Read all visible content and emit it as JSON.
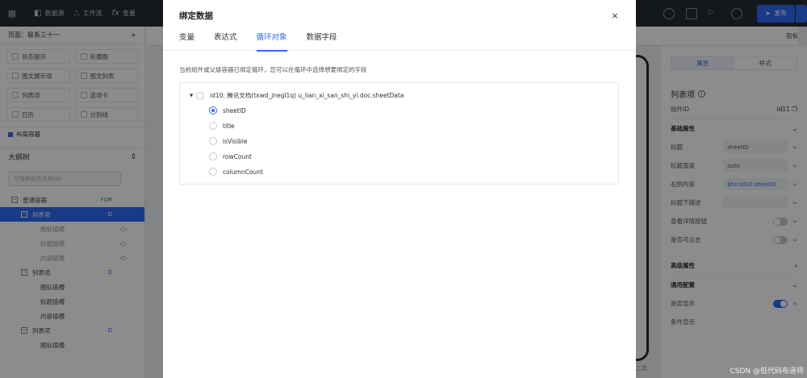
{
  "background": {
    "topbar": {
      "nav": [
        {
          "icon": "database-icon",
          "label": "数据源"
        },
        {
          "icon": "workflow-icon",
          "label": "工作流"
        },
        {
          "icon": "fx-icon",
          "label": "变量"
        }
      ],
      "publish_label": "发布"
    },
    "left_panel": {
      "page_label": "页面：联系三十一",
      "add_label": "+",
      "components": [
        "状态提示",
        "轮播图",
        "图文展示项",
        "图文列表",
        "列表项",
        "选项卡",
        "日历",
        "分割线"
      ],
      "section_label": "布局容器",
      "outline_title": "大纲树",
      "outline_search_placeholder": "可搜索组件名称/ID",
      "tree": [
        {
          "label": "普通容器",
          "badge": "FOR"
        },
        {
          "label": "列表项",
          "badge": "D",
          "selected": true
        },
        {
          "label": "图标插槽"
        },
        {
          "label": "标题插槽"
        },
        {
          "label": "内容插槽"
        },
        {
          "label": "列表项",
          "badge": "D"
        },
        {
          "label": "图标插槽"
        },
        {
          "label": "标题插槽"
        },
        {
          "label": "内容插槽"
        },
        {
          "label": "列表项",
          "badge": "D"
        },
        {
          "label": "图标插槽"
        }
      ]
    },
    "canvas": {
      "layers_label": "面板",
      "footer_label": "工具"
    },
    "right_panel": {
      "tabs": [
        "属性",
        "样式"
      ],
      "title": "列表项",
      "component_id_label": "组件ID",
      "component_id_value": "id11",
      "basic_group": "基础属性",
      "fields": [
        {
          "label": "标题",
          "value": "sheetID"
        },
        {
          "label": "标题宽度",
          "value": "auto"
        },
        {
          "label": "右侧内容",
          "value": "$for.id10.sheetID"
        },
        {
          "label": "标题下描述",
          "value": ""
        }
      ],
      "toggles": [
        {
          "label": "查看详情按钮",
          "on": false
        },
        {
          "label": "是否可点击",
          "on": false
        }
      ],
      "advanced_group": "高级属性",
      "general_group": "通用配置",
      "general_toggles": [
        {
          "label": "是否显示",
          "on": true
        }
      ],
      "cut_label": "条件显示"
    },
    "watermark": "CSDN @低代码布道师"
  },
  "modal": {
    "title": "绑定数据",
    "close_label": "×",
    "tabs": [
      "变量",
      "表达式",
      "循环对象",
      "数据字段"
    ],
    "active_tab": 2,
    "hint": "当前组件或父级容器已绑定循环，您可以在循环中选择想要绑定的字段",
    "tree": {
      "root_label": "id10: 腾讯文档(txwd_jnegl1q) u_lian_xi_san_shi_yi.doc.sheetData",
      "fields": [
        {
          "label": "sheetID",
          "checked": true
        },
        {
          "label": "title",
          "checked": false
        },
        {
          "label": "isVisible",
          "checked": false
        },
        {
          "label": "rowCount",
          "checked": false
        },
        {
          "label": "columnCount",
          "checked": false
        }
      ]
    }
  }
}
